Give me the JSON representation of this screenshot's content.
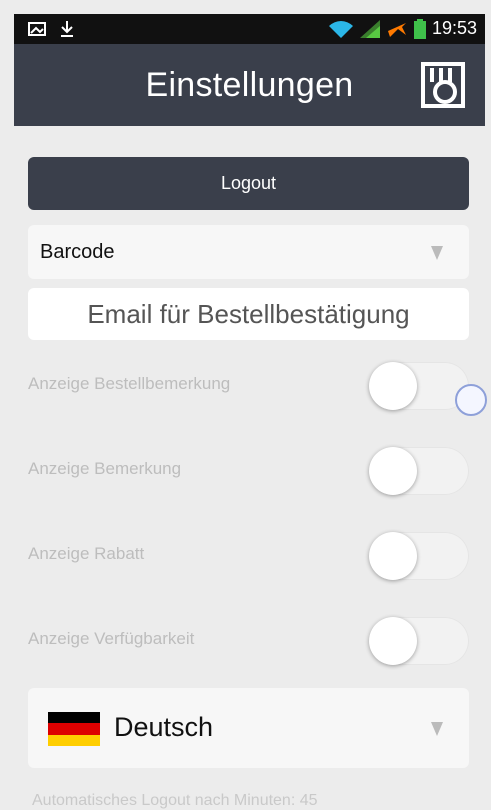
{
  "status_bar": {
    "time": "19:53",
    "icons": [
      "image-icon",
      "download-icon",
      "wifi-icon",
      "signal-icon",
      "airplane-mode-icon",
      "battery-icon"
    ]
  },
  "header": {
    "title": "Einstellungen",
    "logo": "app-logo-icon"
  },
  "logout_label": "Logout",
  "barcode_select": {
    "value": "Barcode"
  },
  "email_field": {
    "placeholder": "Email für Bestellbestätigung"
  },
  "toggles": [
    {
      "label": "Anzeige Bestellbemerkung",
      "on": false
    },
    {
      "label": "Anzeige Bemerkung",
      "on": false
    },
    {
      "label": "Anzeige Rabatt",
      "on": false
    },
    {
      "label": "Anzeige Verfügbarkeit",
      "on": false
    }
  ],
  "language_select": {
    "value": "Deutsch",
    "flag_colors": [
      "#000000",
      "#dd0000",
      "#ffce00"
    ]
  },
  "auto_logout_note": "Automatisches Logout nach Minuten: 45",
  "colors": {
    "header": "#3a3f4b",
    "background": "#ececec"
  }
}
